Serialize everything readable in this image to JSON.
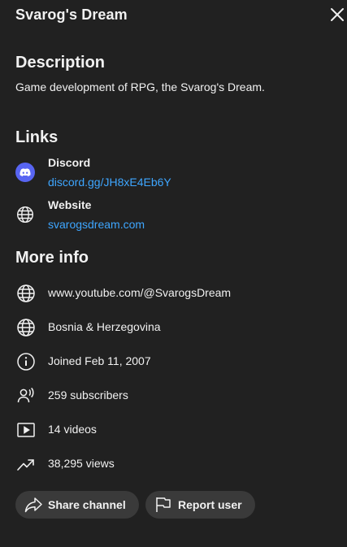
{
  "header": {
    "title": "Svarog's Dream",
    "close_icon": "close-icon"
  },
  "description": {
    "heading": "Description",
    "text": "Game development of RPG, the Svarog's Dream."
  },
  "links": {
    "heading": "Links",
    "items": [
      {
        "label": "Discord",
        "url": "discord.gg/JH8xE4Eb6Y",
        "icon": "discord-icon",
        "accent": "#5865f2"
      },
      {
        "label": "Website",
        "url": "svarogsdream.com",
        "icon": "globe-icon"
      }
    ],
    "link_color": "#3ea6ff"
  },
  "more_info": {
    "heading": "More info",
    "items": [
      {
        "text": "www.youtube.com/@SvarogsDream",
        "icon": "globe-icon"
      },
      {
        "text": "Bosnia & Herzegovina",
        "icon": "globe-icon"
      },
      {
        "text": "Joined Feb 11, 2007",
        "icon": "info-icon"
      },
      {
        "text": "259 subscribers",
        "icon": "subscribers-icon"
      },
      {
        "text": "14 videos",
        "icon": "video-icon"
      },
      {
        "text": "38,295 views",
        "icon": "trending-icon"
      }
    ]
  },
  "actions": {
    "share_label": "Share channel",
    "share_icon": "share-icon",
    "report_label": "Report user",
    "report_icon": "flag-icon"
  },
  "colors": {
    "background": "#212121",
    "text": "#f1f1f1",
    "button_bg": "#3a3a3a"
  }
}
